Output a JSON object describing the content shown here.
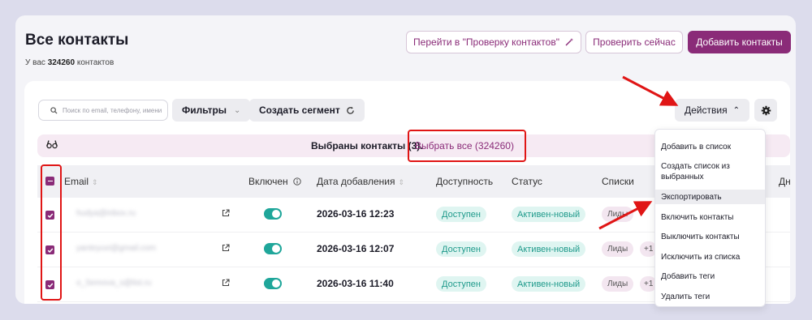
{
  "header": {
    "title": "Все контакты",
    "subtitle_prefix": "У вас",
    "contact_count": "324260",
    "subtitle_suffix": "контактов",
    "goto_check_label": "Перейти в \"Проверку контактов\"",
    "check_now_label": "Проверить сейчас",
    "add_contacts_label": "Добавить контакты"
  },
  "toolbar": {
    "search_placeholder": "Поиск по email, телефону, имени",
    "filters_label": "Фильтры",
    "create_segment_label": "Создать сегмент",
    "actions_label": "Действия"
  },
  "banner": {
    "selected_text": "Выбраны контакты (3).",
    "select_all_label": "Выбрать все (324260)"
  },
  "table": {
    "columns": [
      "Email",
      "Включен",
      "Дата добавления",
      "Доступность",
      "Статус",
      "Списки",
      "Дн"
    ],
    "rows": [
      {
        "email": "hudya@inbox.ru",
        "date": "2026-03-16 12:23",
        "availability": "Доступен",
        "status": "Активен-новый",
        "list": "Лиды",
        "more": ""
      },
      {
        "email": "yanteyuvi@gmail.com",
        "date": "2026-03-16 12:07",
        "availability": "Доступен",
        "status": "Активен-новый",
        "list": "Лиды",
        "more": "+1"
      },
      {
        "email": "o_Semova_s@list.ru",
        "date": "2026-03-16 11:40",
        "availability": "Доступен",
        "status": "Активен-новый",
        "list": "Лиды",
        "more": "+1"
      }
    ]
  },
  "actions_menu": {
    "items": [
      "Добавить в список",
      "Создать список из выбранных",
      "Экспортировать",
      "Включить контакты",
      "Выключить контакты",
      "Исключить из списка",
      "Добавить теги",
      "Удалить теги"
    ],
    "highlighted": "Экспортировать"
  },
  "colors": {
    "accent": "#8a2b78",
    "annotation_red": "#e01515",
    "toggle_on": "#1fa69a",
    "background": "#dcdcec"
  }
}
